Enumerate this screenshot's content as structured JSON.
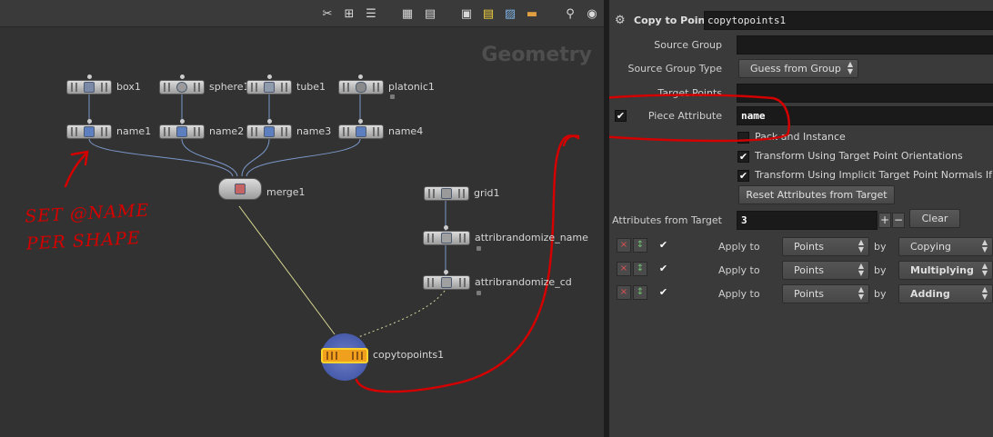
{
  "network": {
    "watermark": "Geometry",
    "toolbar_icons": [
      "tools-icon",
      "tree-icon",
      "list-icon",
      "color-palette-icon",
      "grid-icon",
      "network-box-icon",
      "sticky-note-icon",
      "image-icon",
      "folder-icon",
      "search-icon",
      "eye-icon"
    ],
    "nodes": {
      "box1": "box1",
      "sphere1": "sphere1",
      "tube1": "tube1",
      "platonic1": "platonic1",
      "name1": "name1",
      "name2": "name2",
      "name3": "name3",
      "name4": "name4",
      "merge1": "merge1",
      "grid1": "grid1",
      "attribrandomize_name": "attribrandomize_name",
      "attribrandomize_cd": "attribrandomize_cd",
      "copytopoints1": "copytopoints1"
    },
    "annotation": {
      "line1": "SET @NAME",
      "line2": "PER SHAPE",
      "color": "#d40000"
    }
  },
  "params": {
    "node_type": "Copy to Points",
    "node_name": "copytopoints1",
    "source_group_label": "Source Group",
    "source_group_value": "",
    "source_group_type_label": "Source Group Type",
    "source_group_type_value": "Guess from Group",
    "target_points_label": "Target Points",
    "target_points_value": "",
    "piece_attribute_label": "Piece Attribute",
    "piece_attribute_value": "name",
    "pack_and_instance_label": "Pack and Instance",
    "transform_orient_label": "Transform Using Target Point Orientations",
    "transform_normals_label": "Transform Using Implicit Target Point Normals If No P",
    "reset_button": "Reset Attributes from Target",
    "attributes_from_target_label": "Attributes from Target",
    "attributes_from_target_value": "3",
    "plus_label": "+",
    "minus_label": "−",
    "clear_label": "Clear",
    "rows": [
      {
        "apply_label": "Apply to",
        "apply_value": "Points",
        "by_label": "by",
        "mode": "Copying"
      },
      {
        "apply_label": "Apply to",
        "apply_value": "Points",
        "by_label": "by",
        "mode": "Multiplying"
      },
      {
        "apply_label": "Apply to",
        "apply_value": "Points",
        "by_label": "by",
        "mode": "Adding"
      }
    ]
  }
}
